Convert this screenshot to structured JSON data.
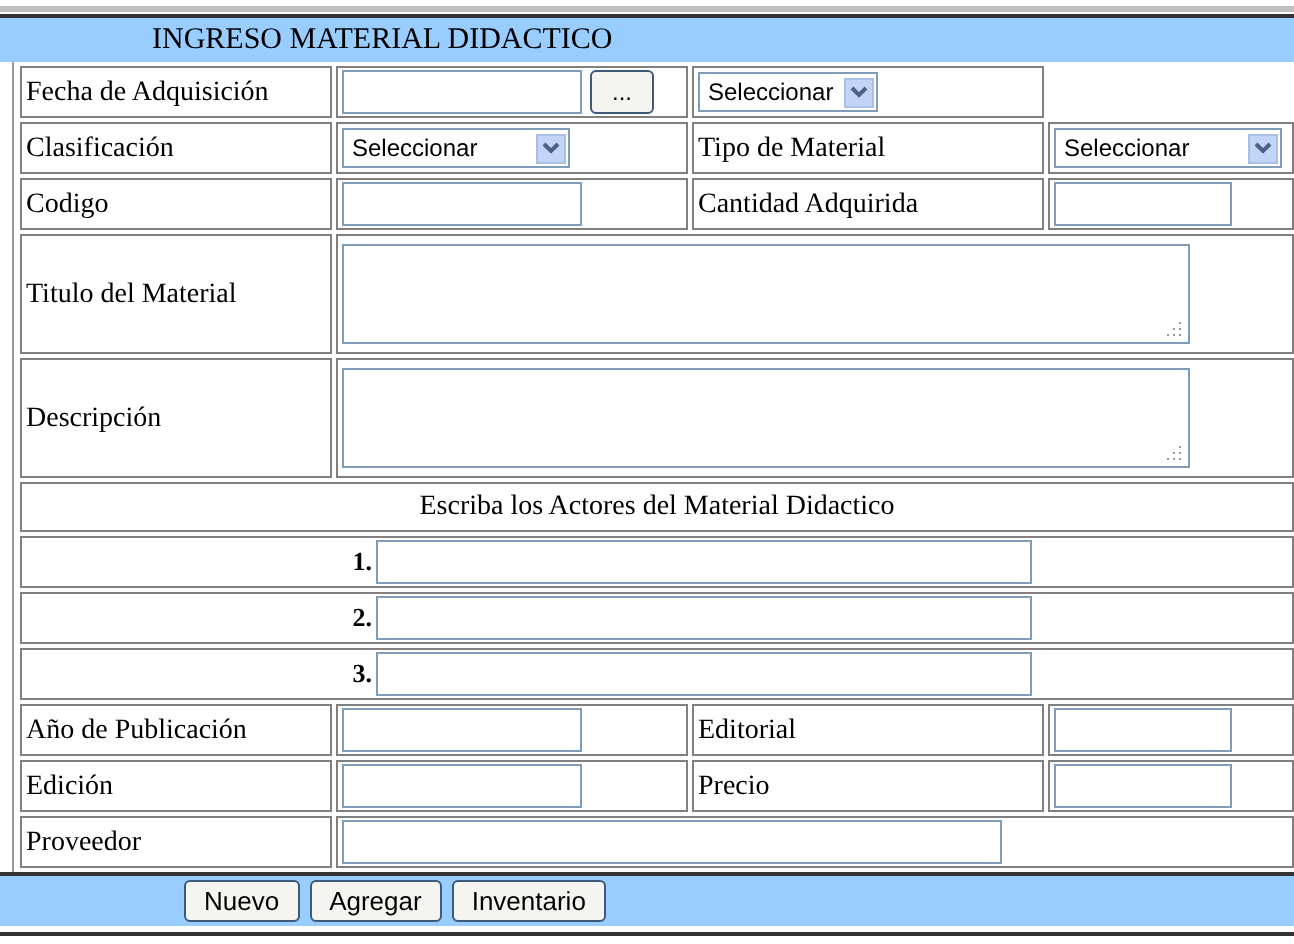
{
  "title": "INGRESO MATERIAL DIDACTICO",
  "rows": [
    {
      "cells": [
        {
          "kind": "label",
          "text": "Fecha de Adquisición"
        },
        {
          "kind": "date",
          "button": "..."
        },
        {
          "kind": "select",
          "value": "Seleccionar",
          "wide": false
        }
      ]
    },
    {
      "cells": [
        {
          "kind": "label",
          "text": "Clasificación"
        },
        {
          "kind": "select",
          "value": "Seleccionar",
          "wide": true
        },
        {
          "kind": "label",
          "text": "Tipo de Material"
        },
        {
          "kind": "select",
          "value": "Seleccionar",
          "wide": true
        }
      ]
    },
    {
      "cells": [
        {
          "kind": "label",
          "text": "Codigo"
        },
        {
          "kind": "input"
        },
        {
          "kind": "label",
          "text": "Cantidad Adquirida"
        },
        {
          "kind": "input"
        }
      ]
    },
    {
      "cells": [
        {
          "kind": "label",
          "text": "Titulo del Material"
        },
        {
          "kind": "textarea"
        }
      ]
    },
    {
      "cells": [
        {
          "kind": "label",
          "text": "Descripción"
        },
        {
          "kind": "textarea"
        }
      ]
    },
    {
      "cells": [
        {
          "kind": "heading",
          "text": "Escriba los Actores del Material Didactico"
        }
      ]
    },
    {
      "cells": [
        {
          "kind": "author",
          "number": "1."
        }
      ]
    },
    {
      "cells": [
        {
          "kind": "author",
          "number": "2."
        }
      ]
    },
    {
      "cells": [
        {
          "kind": "author",
          "number": "3."
        }
      ]
    },
    {
      "cells": [
        {
          "kind": "label",
          "text": "Año de Publicación"
        },
        {
          "kind": "input"
        },
        {
          "kind": "label",
          "text": "Editorial"
        },
        {
          "kind": "input"
        }
      ]
    },
    {
      "cells": [
        {
          "kind": "label",
          "text": "Edición"
        },
        {
          "kind": "input"
        },
        {
          "kind": "label",
          "text": "Precio"
        },
        {
          "kind": "input"
        }
      ]
    },
    {
      "cells": [
        {
          "kind": "label",
          "text": "Proveedor"
        },
        {
          "kind": "longinput"
        }
      ]
    }
  ],
  "buttons": [
    "Nuevo",
    "Agregar",
    "Inventario"
  ]
}
